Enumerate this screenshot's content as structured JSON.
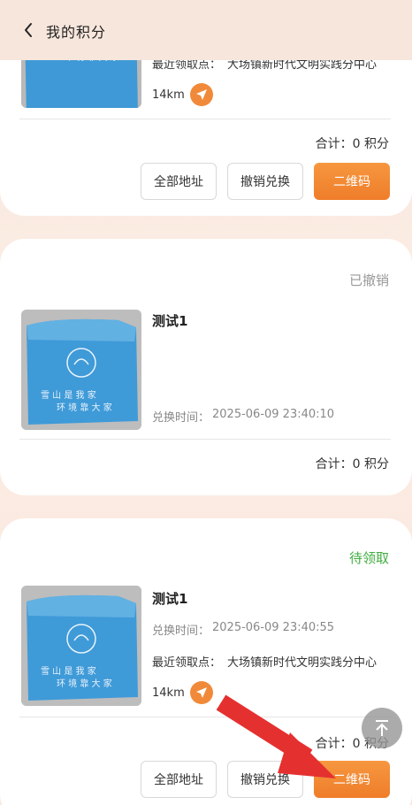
{
  "header": {
    "title": "我的积分"
  },
  "cards": [
    {
      "pickup_label": "最近领取点：",
      "pickup_value": "大场镇新时代文明实践分中心",
      "distance": "14km",
      "total": "合计：0 积分",
      "buttons": {
        "all_address": "全部地址",
        "cancel": "撤销兑换",
        "qrcode": "二维码"
      }
    },
    {
      "status": "已撤销",
      "status_color": "#999999",
      "title": "测试1",
      "exchange_label": "兑换时间：",
      "exchange_time": "2025-06-09 23:40:10",
      "total": "合计：0 积分"
    },
    {
      "status": "待领取",
      "status_color": "#3fae3f",
      "title": "测试1",
      "exchange_label": "兑换时间：",
      "exchange_time": "2025-06-09 23:40:55",
      "pickup_label": "最近领取点：",
      "pickup_value": "大场镇新时代文明实践分中心",
      "distance": "14km",
      "total": "合计：0 积分",
      "buttons": {
        "all_address": "全部地址",
        "cancel": "撤销兑换",
        "qrcode": "二维码"
      }
    }
  ],
  "product_image_text": [
    "雪山是我家",
    "环境靠大家"
  ],
  "colors": {
    "accent": "#f08a3a",
    "annotation_arrow": "#e53030"
  }
}
